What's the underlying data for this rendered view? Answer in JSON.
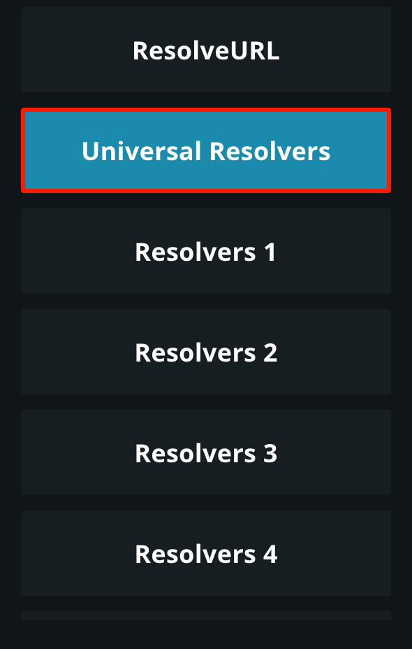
{
  "menu": {
    "items": [
      {
        "label": "ResolveURL",
        "selected": false
      },
      {
        "label": "Universal Resolvers",
        "selected": true
      },
      {
        "label": "Resolvers 1",
        "selected": false
      },
      {
        "label": "Resolvers 2",
        "selected": false
      },
      {
        "label": "Resolvers 3",
        "selected": false
      },
      {
        "label": "Resolvers 4",
        "selected": false
      }
    ]
  },
  "colors": {
    "background": "#0f1518",
    "item_bg": "#171e22",
    "selected_bg": "#1a8aad",
    "highlight_border": "#ff1a00",
    "text": "#ffffff"
  }
}
